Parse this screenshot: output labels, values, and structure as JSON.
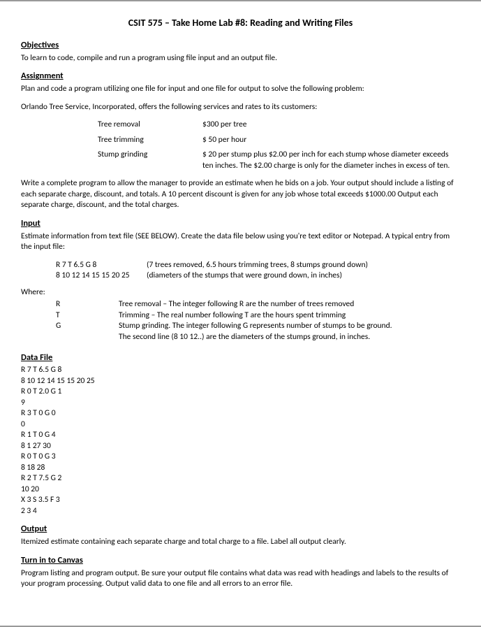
{
  "title": "CSIT 575 – Take Home Lab #8: Reading and Writing Files",
  "objectives": {
    "head": "Objectives",
    "body": "To learn to code, compile and run a program using file input and an output file."
  },
  "assignment": {
    "head": "Assignment",
    "p1": "Plan and code a program utilizing one file for input and one file for output to solve the following problem:",
    "p2": "Orlando Tree Service, Incorporated, offers the following services and rates to its customers:",
    "services": [
      {
        "name": "Tree removal",
        "rate": "$300 per tree"
      },
      {
        "name": "Tree trimming",
        "rate": "$ 50 per hour"
      },
      {
        "name": "Stump grinding",
        "rate": "$ 20 per stump plus $2.00 per inch for each stump whose diameter exceeds ten inches. The $2.00 charge is only for the diameter inches in excess of ten."
      }
    ],
    "p3": "Write a complete program to allow the manager to provide an estimate when he bids on a job. Your output should include a listing of each separate charge, discount, and totals. A 10 percent discount is given for any job whose total exceeds $1000.00 Output each separate charge, discount, and the total charges."
  },
  "input": {
    "head": "Input",
    "p1": "Estimate information from text file (SEE BELOW). Create the data file below using you're text editor or Notepad. A typical entry from the input file:",
    "example": [
      {
        "code": "R 7 T 6.5 G 8",
        "desc": "(7 trees removed, 6.5 hours trimming trees, 8 stumps ground down)"
      },
      {
        "code": "8 10 12 14 15 15 20 25",
        "desc": "(diameters of the stumps that were ground down, in inches)"
      }
    ],
    "where_label": "Where:",
    "where": [
      {
        "k": "R",
        "v": "Tree removal – The integer following R are the number of trees removed"
      },
      {
        "k": "T",
        "v": "Trimming – The real number following T are the hours spent trimming"
      },
      {
        "k": "G",
        "v": "Stump grinding. The integer following G represents number of stumps to be ground."
      },
      {
        "k": "",
        "v": "The second line (8 10 12..) are the diameters of the stumps ground, in inches."
      }
    ]
  },
  "datafile": {
    "head": "Data File",
    "content": "R 7 T 6.5 G 8\n8 10 12 14 15 15 20 25\nR 0 T 2.0 G 1\n9\nR 3 T 0 G 0\n0\nR 1 T 0 G 4\n8 1 27 30\nR 0 T 0 G 3\n8 18 28\nR 2 T 7.5 G 2\n10 20\nX 3 S 3.5 F 3\n2 3 4"
  },
  "output": {
    "head": "Output",
    "body": "Itemized estimate containing each separate charge and total charge to a file. Label all output clearly."
  },
  "turnin": {
    "head": "Turn in to Canvas",
    "body": "Program listing and program output. Be sure your output file contains what data was read with headings and labels to the results of your program processing. Output valid data to one file and all errors to an error file."
  }
}
